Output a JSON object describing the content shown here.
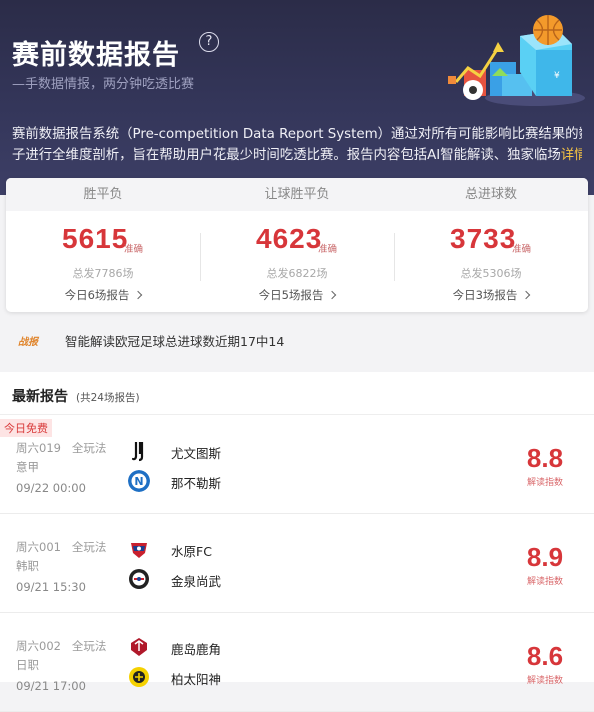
{
  "header": {
    "title": "赛前数据报告",
    "subtitle": "—手数据情报，两分钟吃透比赛",
    "desc_line1": "赛前数据报告系统（Pre-competition Data Report System）通过对所有可能影响比赛结果的数据因",
    "desc_line2": "子进行全维度剖析，旨在帮助用户花最少时间吃透比赛。报告内容包括AI智能解读、独家临场",
    "more_label": "详情>",
    "help_icon": "question-icon"
  },
  "stats": {
    "tabs": [
      "胜平负",
      "让球胜平负",
      "总进球数"
    ],
    "items": [
      {
        "value": "5615",
        "accuracy_label": "准确",
        "total": "总发7786场",
        "today": "今日6场报告"
      },
      {
        "value": "4623",
        "accuracy_label": "准确",
        "total": "总发6822场",
        "today": "今日5场报告"
      },
      {
        "value": "3733",
        "accuracy_label": "准确",
        "total": "总发5306场",
        "today": "今日3场报告"
      }
    ]
  },
  "news": {
    "badge": "战报",
    "text": "智能解读欧冠足球总进球数近期17中14"
  },
  "list": {
    "title": "最新报告",
    "count": "(共24场报告)",
    "matches": [
      {
        "free_tag": "今日免费",
        "code": "周六019",
        "play": "全玩法",
        "league": "意甲",
        "time": "09/22 00:00",
        "home": "尤文图斯",
        "away": "那不勒斯",
        "score": "8.8",
        "score_label": "解读指数"
      },
      {
        "free_tag": "",
        "code": "周六001",
        "play": "全玩法",
        "league": "韩职",
        "time": "09/21 15:30",
        "home": "水原FC",
        "away": "金泉尚武",
        "score": "8.9",
        "score_label": "解读指数"
      },
      {
        "free_tag": "",
        "code": "周六002",
        "play": "全玩法",
        "league": "日职",
        "time": "09/21 17:00",
        "home": "鹿岛鹿角",
        "away": "柏太阳神",
        "score": "8.6",
        "score_label": "解读指数"
      }
    ]
  },
  "colors": {
    "accent_red": "#d7363a",
    "header_bg": "#2b2c48",
    "detail_link": "#f6c343"
  }
}
